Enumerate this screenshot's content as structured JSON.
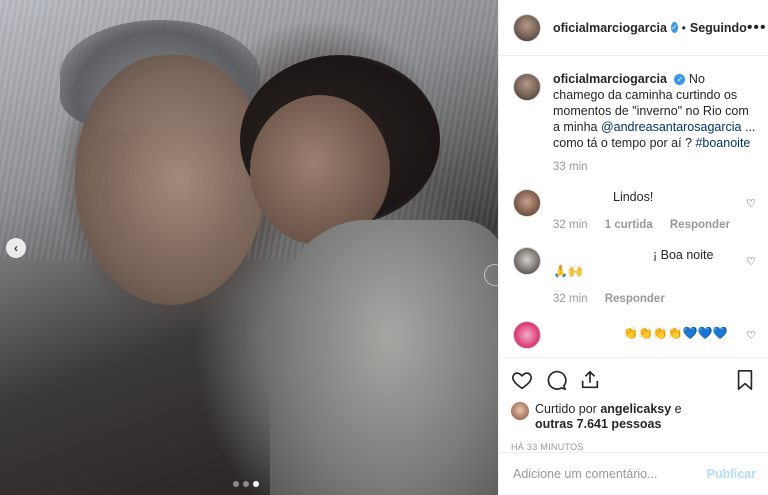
{
  "post": {
    "username": "oficialmarciogarcia",
    "follow_status": "Seguindo",
    "more_label": "•••",
    "caption_pre": "No chamego da caminha curtindo os momentos de \"inverno\" no Rio com a minha ",
    "caption_mention": "@andreasantarosagarcia",
    "caption_mid": " ... como tá o tempo por aí ? ",
    "caption_hashtag": "#boanoite",
    "caption_time": "33 min"
  },
  "comments": [
    {
      "text": "Lindos!",
      "time": "32 min",
      "likes": "1 curtida",
      "reply": "Responder"
    },
    {
      "text": "¡ Boa noite",
      "emoji": "🙏🙌",
      "time": "32 min",
      "reply": "Responder"
    },
    {
      "text": "👏👏👏👏💙💙💙"
    }
  ],
  "likes": {
    "prefix": "Curtido por ",
    "user": "angelicaksy",
    "mid": " e ",
    "others": "outras 7.641 pessoas"
  },
  "timestamp": "HÁ 33 MINUTOS",
  "add_comment": {
    "placeholder": "Adicione um comentário...",
    "publish": "Publicar"
  },
  "colors": {
    "accent": "#3897f0",
    "link": "#003569",
    "muted": "#999999",
    "publish_disabled": "#b3dbff"
  },
  "carousel": {
    "slides": 3,
    "active": 3
  }
}
